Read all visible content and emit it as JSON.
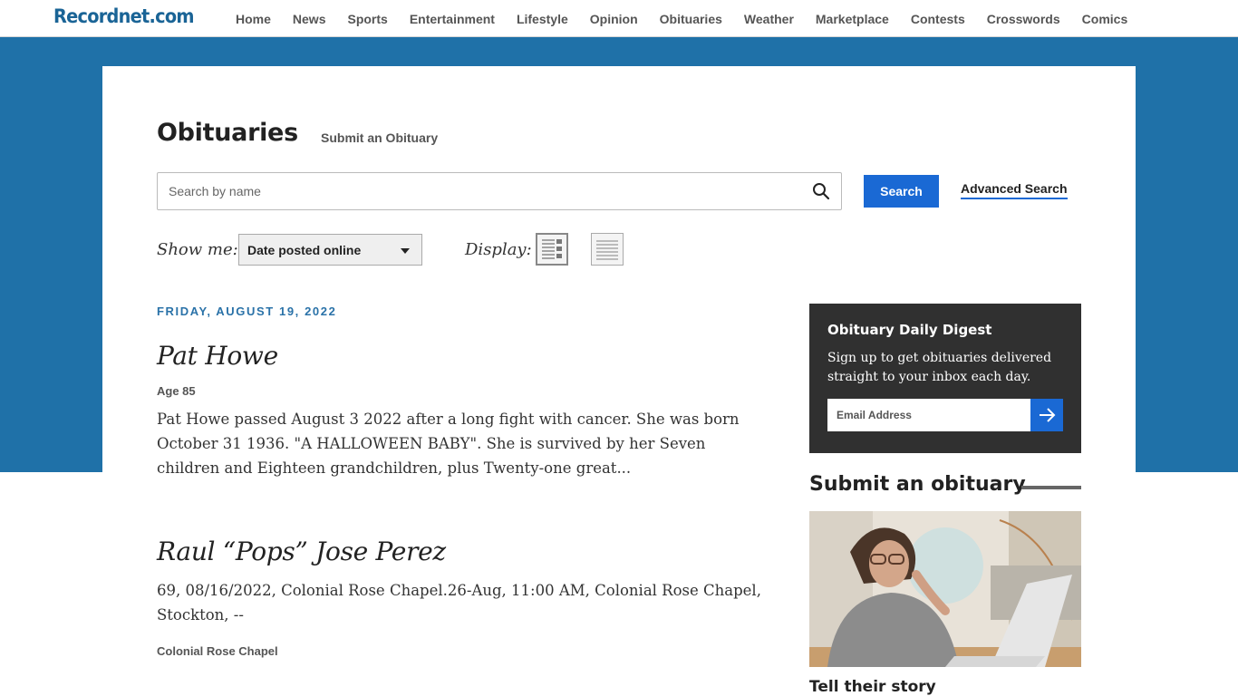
{
  "site": {
    "logo": "Recordnet.com"
  },
  "nav": {
    "items": [
      {
        "label": "Home"
      },
      {
        "label": "News"
      },
      {
        "label": "Sports"
      },
      {
        "label": "Entertainment"
      },
      {
        "label": "Lifestyle"
      },
      {
        "label": "Opinion"
      },
      {
        "label": "Obituaries"
      },
      {
        "label": "Weather"
      },
      {
        "label": "Marketplace"
      },
      {
        "label": "Contests"
      },
      {
        "label": "Crosswords"
      },
      {
        "label": "Comics"
      }
    ]
  },
  "header": {
    "title": "Obituaries",
    "submit_link": "Submit an Obituary"
  },
  "search": {
    "placeholder": "Search by name",
    "value": "",
    "button_label": "Search",
    "advanced_label": "Advanced Search"
  },
  "filters": {
    "show_me_label": "Show me:",
    "show_me_value": "Date posted online",
    "display_label": "Display:"
  },
  "listing": {
    "date_heading": "FRIDAY, AUGUST 19, 2022",
    "obituaries": [
      {
        "name": "Pat Howe",
        "age": "Age 85",
        "excerpt": "Pat Howe passed August 3 2022 after a long fight with cancer. She was born October 31 1936. \"A HALLOWEEN BABY\". She is survived by her Seven children and Eighteen grandchildren, plus Twenty-one great..."
      },
      {
        "name": "Raul “Pops” Jose Perez",
        "excerpt": "69, 08/16/2022, Colonial Rose Chapel.26-Aug, 11:00 AM, Colonial Rose Chapel, Stockton, --",
        "funeral_home": "Colonial Rose Chapel"
      }
    ]
  },
  "sidebar": {
    "digest": {
      "title": "Obituary Daily Digest",
      "text": "Sign up to get obituaries delivered straight to your inbox each day.",
      "email_placeholder": "Email Address"
    },
    "submit": {
      "heading": "Submit an obituary",
      "caption": "Tell their story"
    }
  },
  "colors": {
    "brand_blue": "#1f71a8",
    "button_blue": "#1a69d4",
    "digest_bg": "#303030"
  }
}
